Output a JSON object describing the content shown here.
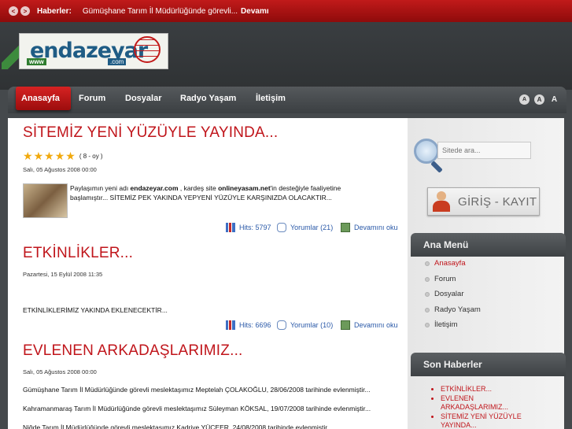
{
  "ticker": {
    "label": "Haberler:",
    "text": "Gümüşhane Tarım İl Müdürlüğünde görevli...",
    "more": "Devamı"
  },
  "logo": {
    "main": "endazeyar",
    "www": "www",
    "com": ".com"
  },
  "nav": {
    "items": [
      "Anasayfa",
      "Forum",
      "Dosyalar",
      "Radyo Yaşam",
      "İletişim"
    ],
    "font_sizes": [
      "A",
      "A",
      "A"
    ]
  },
  "articles": [
    {
      "title": "SİTEMİZ YENİ YÜZÜYLE YAYINDA...",
      "rating": {
        "stars": 5,
        "text": "( 8 - oy )"
      },
      "date": "Salı, 05 Ağustos 2008 00:00",
      "body_pre": "Paylaşımın yeni adı ",
      "body_bold1": "endazeyar.com",
      "body_mid": " , kardeş site ",
      "body_bold2": "onlineyasam.net",
      "body_post": "'in desteğiyle faaliyetine başlamıştır... SİTEMİZ PEK YAKINDA YEPYENİ YÜZÜYLE KARŞINIZDA OLACAKTIR...",
      "hits": "Hits: 5797",
      "comments": "Yorumlar (21)",
      "more": "Devamını oku"
    },
    {
      "title": "ETKİNLİKLER...",
      "date": "Pazartesi, 15 Eylül 2008 11:35",
      "body": "ETKİNLİKLERİMİZ YAKINDA EKLENECEKTİR...",
      "hits": "Hits: 6696",
      "comments": "Yorumlar (10)",
      "more": "Devamını oku"
    },
    {
      "title": "EVLENEN ARKADAŞLARIMIZ...",
      "date": "Salı, 05 Ağustos 2008 00:00",
      "lines": [
        "Gümüşhane Tarım İl Müdürlüğünde görevli meslektaşımız Meptelah ÇOLAKOĞLU, 28/06/2008 tarihinde evlenmiştir...",
        "Kahramanmaraş Tarım İl Müdürlüğünde görevli meslektaşımız Süleyman KÖKSAL, 19/07/2008 tarihinde evlenmiştir...",
        "Niğde Tarım İl Müdürlüğünde görevli meslektaşımız Kadriye YÜCEER, 24/08/2008 tarihinde evlenmiştir..."
      ]
    }
  ],
  "sidebar": {
    "search_placeholder": "Sitede ara...",
    "login": "GİRİŞ - KAYIT",
    "main_menu_title": "Ana Menü",
    "main_menu": [
      "Anasayfa",
      "Forum",
      "Dosyalar",
      "Radyo Yaşam",
      "İletişim"
    ],
    "news_title": "Son Haberler",
    "news": [
      "ETKİNLİKLER...",
      "EVLENEN ARKADAŞLARIMIZ...",
      "SİTEMİZ YENİ YÜZÜYLE YAYINDA..."
    ]
  }
}
